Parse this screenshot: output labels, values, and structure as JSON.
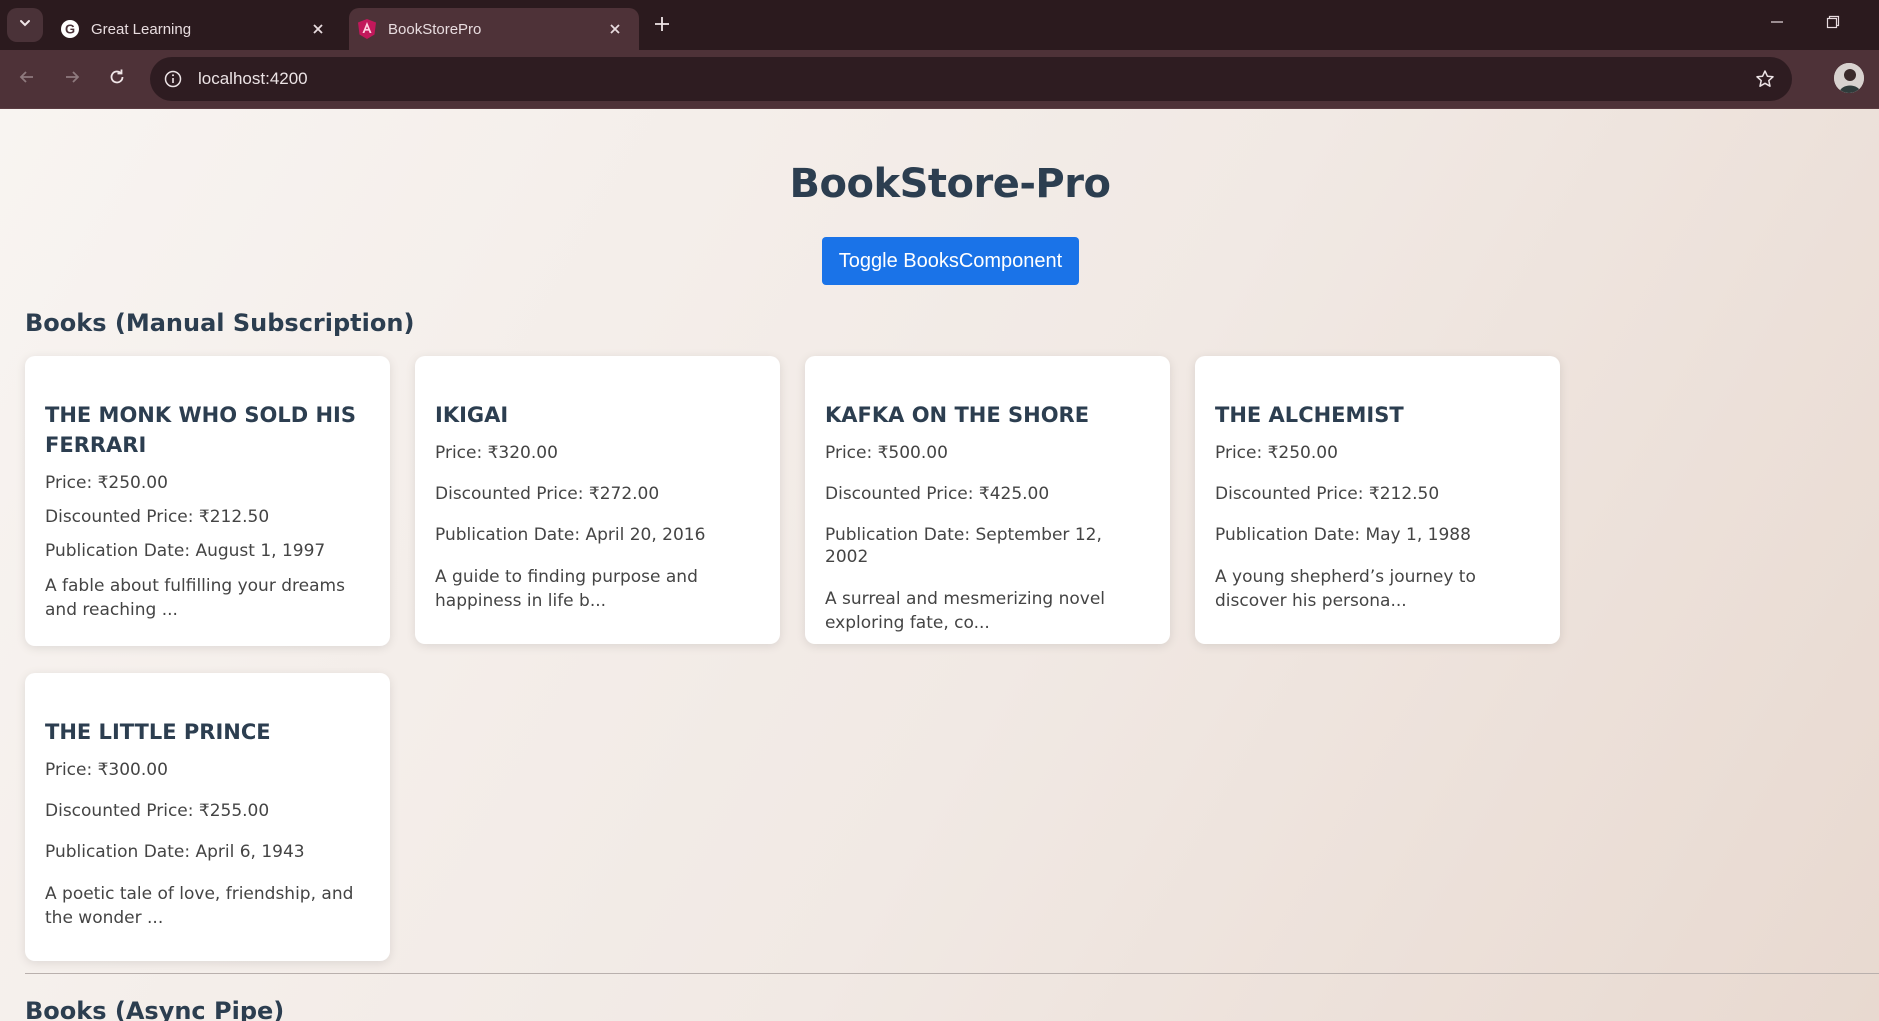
{
  "browser": {
    "tabs": [
      {
        "title": "Great Learning",
        "favicon": "google-g-icon",
        "active": false
      },
      {
        "title": "BookStorePro",
        "favicon": "angular-icon",
        "active": true
      }
    ],
    "url": "localhost:4200"
  },
  "page": {
    "title": "BookStore-Pro",
    "toggle_label": "Toggle BooksComponent",
    "sections": {
      "manual": "Books (Manual Subscription)",
      "async": "Books (Async Pipe)"
    }
  },
  "books": [
    {
      "title": "THE MONK WHO SOLD HIS FERRARI",
      "price": "Price: ₹250.00",
      "discounted": "Discounted Price: ₹212.50",
      "published": "Publication Date: August 1, 1997",
      "description": "A fable about fulfilling your dreams and reaching ..."
    },
    {
      "title": "IKIGAI",
      "price": "Price: ₹320.00",
      "discounted": "Discounted Price: ₹272.00",
      "published": "Publication Date: April 20, 2016",
      "description": "A guide to finding purpose and happiness in life b..."
    },
    {
      "title": "KAFKA ON THE SHORE",
      "price": "Price: ₹500.00",
      "discounted": "Discounted Price: ₹425.00",
      "published": "Publication Date: September 12, 2002",
      "description": "A surreal and mesmerizing novel exploring fate, co..."
    },
    {
      "title": "THE ALCHEMIST",
      "price": "Price: ₹250.00",
      "discounted": "Discounted Price: ₹212.50",
      "published": "Publication Date: May 1, 1988",
      "description": "A young shepherd’s journey to discover his persona..."
    },
    {
      "title": "THE LITTLE PRINCE",
      "price": "Price: ₹300.00",
      "discounted": "Discounted Price: ₹255.00",
      "published": "Publication Date: April 6, 1943",
      "description": "A poetic tale of love, friendship, and the wonder ..."
    }
  ],
  "colors": {
    "accent": "#1a73e8",
    "heading": "#2c3e50",
    "chrome_dark": "#2b1a1e",
    "chrome_toolbar": "#4e3238"
  }
}
